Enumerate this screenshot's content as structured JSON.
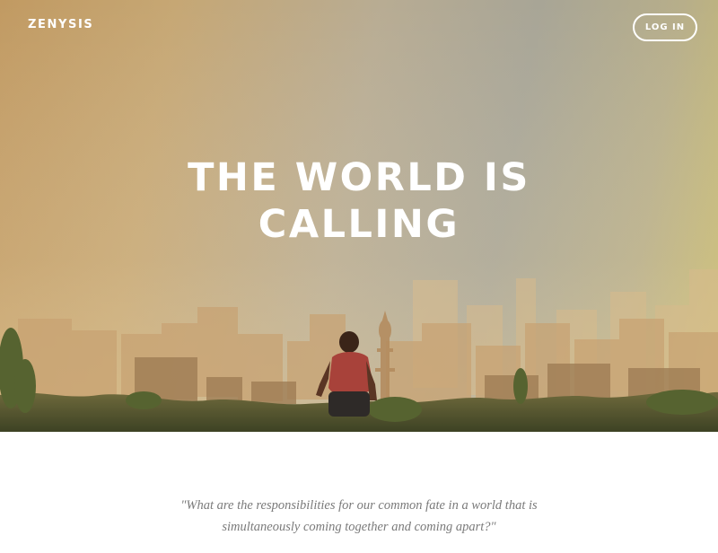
{
  "header": {
    "brand": "ZENYSIS",
    "login_label": "LOG IN"
  },
  "hero": {
    "title": "THE WORLD IS CALLING",
    "image": "runner-over-city-skyline"
  },
  "quote": {
    "text": "\"What are the responsibilities for our common fate in a world that is simultaneously coming together and coming apart?\""
  },
  "colors": {
    "hero_warm": "#c19a62",
    "hero_cool": "#a8a596",
    "hero_yellow": "#c9bc6f",
    "text_white": "#ffffff",
    "quote_text": "#7a7a7a"
  }
}
